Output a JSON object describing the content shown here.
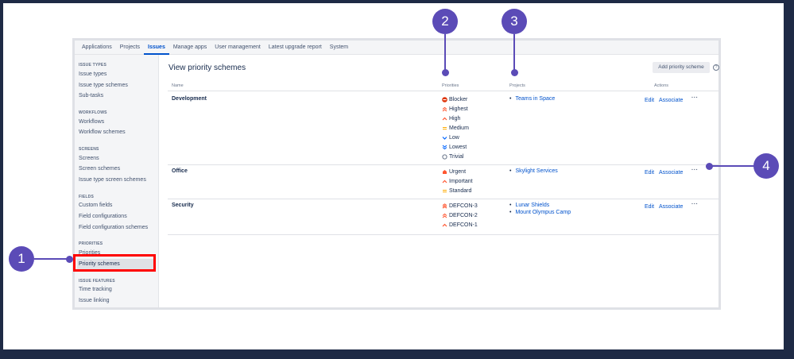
{
  "top_nav": {
    "tabs": [
      "Applications",
      "Projects",
      "Issues",
      "Manage apps",
      "User management",
      "Latest upgrade report",
      "System"
    ],
    "active": "Issues"
  },
  "sidebar": {
    "sections": [
      {
        "heading": "ISSUE TYPES",
        "items": [
          "Issue types",
          "Issue type schemes",
          "Sub-tasks"
        ]
      },
      {
        "heading": "WORKFLOWS",
        "items": [
          "Workflows",
          "Workflow schemes"
        ]
      },
      {
        "heading": "SCREENS",
        "items": [
          "Screens",
          "Screen schemes",
          "Issue type screen schemes"
        ]
      },
      {
        "heading": "FIELDS",
        "items": [
          "Custom fields",
          "Field configurations",
          "Field configuration schemes"
        ]
      },
      {
        "heading": "PRIORITIES",
        "items": [
          "Priorities",
          "Priority schemes"
        ]
      },
      {
        "heading": "ISSUE FEATURES",
        "items": [
          "Time tracking",
          "Issue linking"
        ]
      }
    ],
    "selected": "Priority schemes"
  },
  "main": {
    "title": "View priority schemes",
    "add_button": "Add priority scheme",
    "help_icon": "?",
    "columns": {
      "name": "Name",
      "priorities": "Priorities",
      "projects": "Projects",
      "actions": "Actions"
    },
    "rows": [
      {
        "name": "Development",
        "priorities": [
          {
            "label": "Blocker",
            "icon": "blocker-icon",
            "color": "#de350b"
          },
          {
            "label": "Highest",
            "icon": "highest-icon",
            "color": "#ff5630"
          },
          {
            "label": "High",
            "icon": "high-icon",
            "color": "#ff5630"
          },
          {
            "label": "Medium",
            "icon": "medium-icon",
            "color": "#ffab00"
          },
          {
            "label": "Low",
            "icon": "low-icon",
            "color": "#0065ff"
          },
          {
            "label": "Lowest",
            "icon": "lowest-icon",
            "color": "#0065ff"
          },
          {
            "label": "Trivial",
            "icon": "trivial-icon",
            "color": "#6b778c"
          }
        ],
        "projects": [
          "Teams in Space"
        ],
        "edit": "Edit",
        "associate": "Associate",
        "more": "···"
      },
      {
        "name": "Office",
        "priorities": [
          {
            "label": "Urgent",
            "icon": "urgent-icon",
            "color": "#ff5630"
          },
          {
            "label": "Important",
            "icon": "important-icon",
            "color": "#ff5630"
          },
          {
            "label": "Standard",
            "icon": "standard-icon",
            "color": "#ffab00"
          }
        ],
        "projects": [
          "Skylight Services"
        ],
        "edit": "Edit",
        "associate": "Associate",
        "more": "···"
      },
      {
        "name": "Security",
        "priorities": [
          {
            "label": "DEFCON-3",
            "icon": "defcon-3-icon",
            "color": "#ff5630"
          },
          {
            "label": "DEFCON-2",
            "icon": "defcon-2-icon",
            "color": "#ff5630"
          },
          {
            "label": "DEFCON-1",
            "icon": "defcon-1-icon",
            "color": "#ff5630"
          }
        ],
        "projects": [
          "Lunar Shields",
          "Mount Olympus Camp"
        ],
        "edit": "Edit",
        "associate": "Associate",
        "more": "···"
      }
    ]
  },
  "callouts": [
    "1",
    "2",
    "3",
    "4"
  ],
  "colors": {
    "accent": "#5b4bb7",
    "link": "#0052cc",
    "highlight_box": "#ff0000",
    "background": "#1e2a45"
  }
}
